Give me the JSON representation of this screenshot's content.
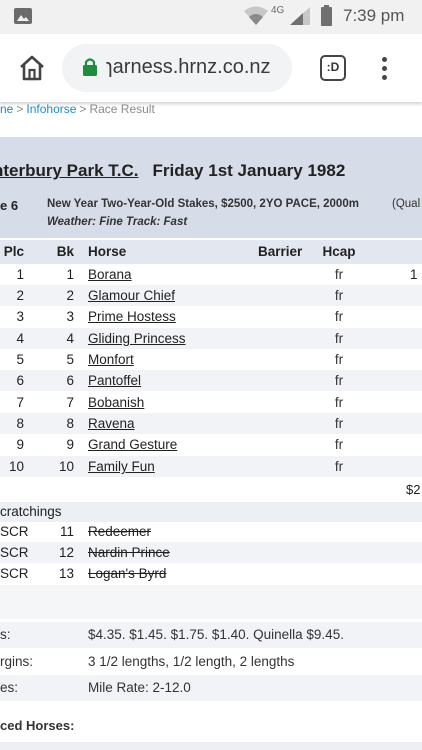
{
  "status_bar": {
    "time": "7:39 pm",
    "network": "4G",
    "icons": [
      "notification-image-icon",
      "wifi-icon",
      "signal-icon",
      "battery-icon"
    ]
  },
  "browser": {
    "url": "ɿarness.hrnz.co.nz",
    "tabs_label": ":D",
    "icons": [
      "home-icon",
      "lock-icon",
      "more-vert-icon"
    ]
  },
  "breadcrumb": {
    "first": "ne",
    "second": "Infohorse",
    "current": "Race Result",
    "separator": ">"
  },
  "race": {
    "venue": "nterbury Park T.C.",
    "date": "Friday  1st  January  1982",
    "race_number": "e 6",
    "description": "New Year Two-Year-Old Stakes, $2500, 2YO PACE, 2000m",
    "extra": "(Qual",
    "weather": "Weather: Fine     Track: Fast"
  },
  "table": {
    "headers": {
      "plc": "Plc",
      "bk": "Bk",
      "horse": "Horse",
      "barrier": "Barrier",
      "hcap": "Hcap"
    },
    "rows": [
      {
        "plc": "1",
        "bk": "1",
        "horse": "Borana",
        "hcap": "fr",
        "extra": "1"
      },
      {
        "plc": "2",
        "bk": "2",
        "horse": "Glamour Chief",
        "hcap": "fr",
        "extra": ""
      },
      {
        "plc": "3",
        "bk": "3",
        "horse": "Prime Hostess",
        "hcap": "fr",
        "extra": ""
      },
      {
        "plc": "4",
        "bk": "4",
        "horse": "Gliding Princess",
        "hcap": "fr",
        "extra": ""
      },
      {
        "plc": "5",
        "bk": "5",
        "horse": "Monfort",
        "hcap": "fr",
        "extra": ""
      },
      {
        "plc": "6",
        "bk": "6",
        "horse": "Pantoffel",
        "hcap": "fr",
        "extra": ""
      },
      {
        "plc": "7",
        "bk": "7",
        "horse": "Bobanish",
        "hcap": "fr",
        "extra": ""
      },
      {
        "plc": "8",
        "bk": "8",
        "horse": "Ravena",
        "hcap": "fr",
        "extra": ""
      },
      {
        "plc": "9",
        "bk": "9",
        "horse": "Grand Gesture",
        "hcap": "fr",
        "extra": ""
      },
      {
        "plc": "10",
        "bk": "10",
        "horse": "Family Fun",
        "hcap": "fr",
        "extra": ""
      }
    ],
    "stake_total": "$2"
  },
  "scratchings": {
    "title": "cratchings",
    "rows": [
      {
        "plc": "SCR",
        "bk": "11",
        "horse": "Redeemer"
      },
      {
        "plc": "SCR",
        "bk": "12",
        "horse": "Nardin Prince"
      },
      {
        "plc": "SCR",
        "bk": "13",
        "horse": "Logan's Byrd"
      }
    ]
  },
  "info": [
    {
      "label": "s:",
      "value": "$4.35. $1.45. $1.75. $1.40. Quinella $9.45."
    },
    {
      "label": "rgins:",
      "value": "3 1/2 lengths, 1/2 length, 2 lengths"
    },
    {
      "label": "es:",
      "value": "Mile Rate: 2-12.0"
    }
  ],
  "placed_horses_title": "ced Horses:"
}
